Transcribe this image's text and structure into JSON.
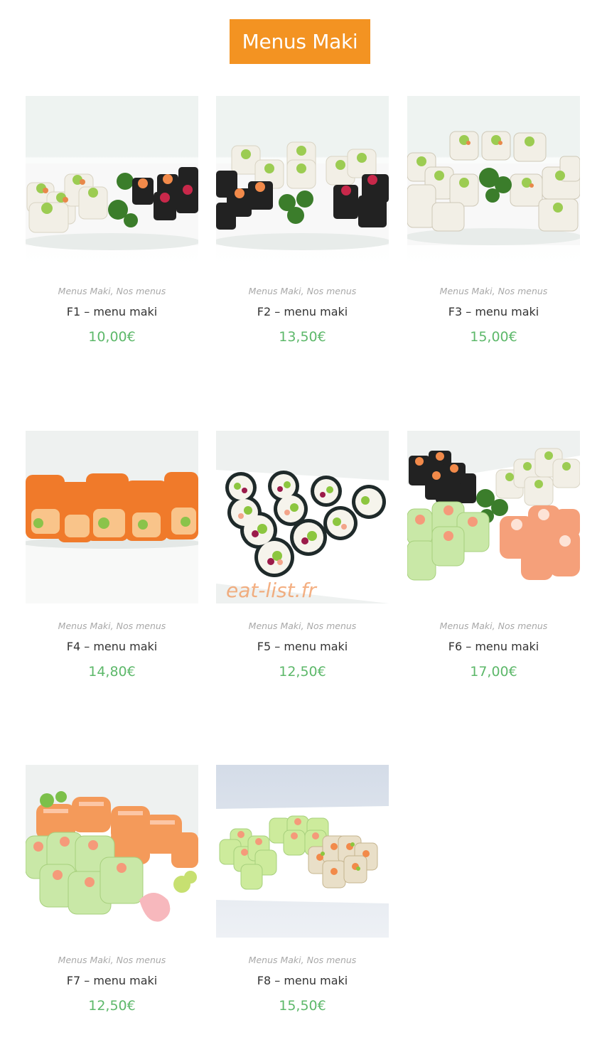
{
  "page": {
    "title": "Menus Maki",
    "watermark": "eat-list.fr"
  },
  "colors": {
    "title_bg": "#f39322",
    "price": "#5db86a",
    "category": "#a8a8a8"
  },
  "products": [
    {
      "cat1": "Menus Maki",
      "sep": ", ",
      "cat2": "Nos menus",
      "name": "F1 – menu maki",
      "price": "10,00€"
    },
    {
      "cat1": "Menus Maki",
      "sep": ", ",
      "cat2": "Nos menus",
      "name": "F2 – menu maki",
      "price": "13,50€"
    },
    {
      "cat1": "Menus Maki",
      "sep": ", ",
      "cat2": "Nos menus",
      "name": "F3 – menu maki",
      "price": "15,00€"
    },
    {
      "cat1": "Menus Maki",
      "sep": ", ",
      "cat2": "Nos menus",
      "name": "F4 – menu maki",
      "price": "14,80€"
    },
    {
      "cat1": "Menus Maki",
      "sep": ", ",
      "cat2": "Nos menus",
      "name": "F5 – menu maki",
      "price": "12,50€"
    },
    {
      "cat1": "Menus Maki",
      "sep": ", ",
      "cat2": "Nos menus",
      "name": "F6 – menu maki",
      "price": "17,00€"
    },
    {
      "cat1": "Menus Maki",
      "sep": ", ",
      "cat2": "Nos menus",
      "name": "F7 – menu maki",
      "price": "12,50€"
    },
    {
      "cat1": "Menus Maki",
      "sep": ", ",
      "cat2": "Nos menus",
      "name": "F8 – menu maki",
      "price": "15,50€"
    }
  ]
}
